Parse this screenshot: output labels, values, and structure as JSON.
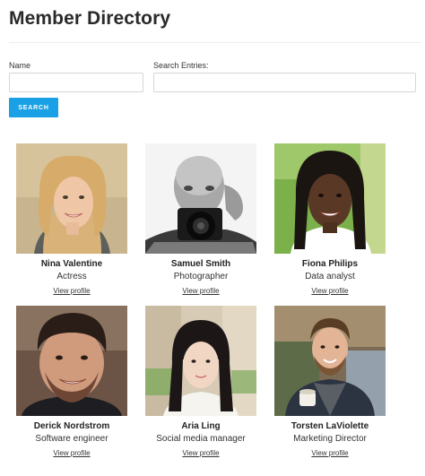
{
  "page": {
    "title": "Member Directory"
  },
  "search": {
    "name_label": "Name",
    "name_value": "",
    "entries_label": "Search Entries:",
    "entries_value": "",
    "button_label": "SEARCH"
  },
  "colors": {
    "accent": "#1aa1e5"
  },
  "members": [
    {
      "name": "Nina Valentine",
      "role": "Actress",
      "link": "View profile"
    },
    {
      "name": "Samuel Smith",
      "role": "Photographer",
      "link": "View profile"
    },
    {
      "name": "Fiona Philips",
      "role": "Data analyst",
      "link": "View profile"
    },
    {
      "name": "Derick Nordstrom",
      "role": "Software engineer",
      "link": "View profile"
    },
    {
      "name": "Aria Ling",
      "role": "Social media manager",
      "link": "View profile"
    },
    {
      "name": "Torsten LaViolette",
      "role": "Marketing Director",
      "link": "View profile"
    }
  ]
}
